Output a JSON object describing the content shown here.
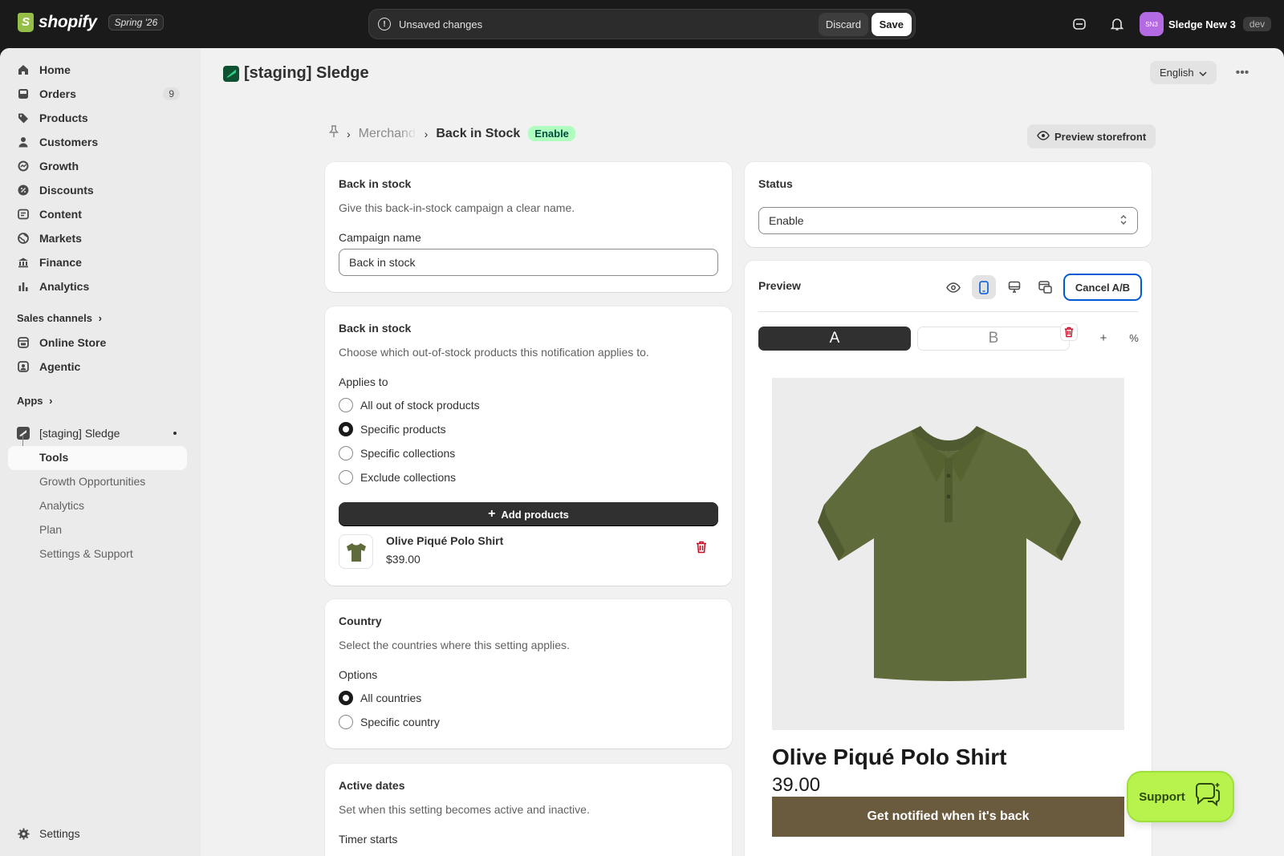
{
  "topbar": {
    "logo_text": "shopify",
    "edition_badge": "Spring '26",
    "unsaved_text": "Unsaved changes",
    "discard_label": "Discard",
    "save_label": "Save",
    "store_initials": "SN3",
    "store_name": "Sledge New 3",
    "env_badge": "dev"
  },
  "sidebar": {
    "items": [
      {
        "label": "Home",
        "icon": "home-icon"
      },
      {
        "label": "Orders",
        "icon": "inbox-icon",
        "count": "9"
      },
      {
        "label": "Products",
        "icon": "tag-icon"
      },
      {
        "label": "Customers",
        "icon": "person-icon"
      },
      {
        "label": "Growth",
        "icon": "growth-icon"
      },
      {
        "label": "Discounts",
        "icon": "discount-icon"
      },
      {
        "label": "Content",
        "icon": "content-icon"
      },
      {
        "label": "Markets",
        "icon": "globe-icon"
      },
      {
        "label": "Finance",
        "icon": "bank-icon"
      },
      {
        "label": "Analytics",
        "icon": "bar-chart-icon"
      }
    ],
    "sales_channels_label": "Sales channels",
    "channels": [
      {
        "label": "Online Store",
        "icon": "store-icon"
      },
      {
        "label": "Agentic",
        "icon": "agent-icon"
      }
    ],
    "apps_label": "Apps",
    "app_name": "[staging] Sledge",
    "app_subitems": [
      "Tools",
      "Growth Opportunities",
      "Analytics",
      "Plan",
      "Settings & Support"
    ],
    "settings_label": "Settings"
  },
  "page": {
    "title": "[staging] Sledge",
    "language": "English",
    "breadcrumb_parent": "Merchandise",
    "breadcrumb_current": "Back in Stock",
    "status_badge": "Enable",
    "preview_storefront_label": "Preview storefront"
  },
  "campaign_card": {
    "title": "Back in stock",
    "subtitle": "Give this back-in-stock campaign a clear name.",
    "field_label": "Campaign name",
    "field_value": "Back in stock"
  },
  "applies_card": {
    "title": "Back in stock",
    "subtitle": "Choose which out-of-stock products this notification applies to.",
    "applies_label": "Applies to",
    "options": [
      "All out of stock products",
      "Specific products",
      "Specific collections",
      "Exclude collections"
    ],
    "selected_index": 1,
    "add_button_label": "Add products",
    "product_name": "Olive Piqué Polo Shirt",
    "product_price": "$39.00"
  },
  "country_card": {
    "title": "Country",
    "subtitle": "Select the countries where this setting applies.",
    "options_label": "Options",
    "options": [
      "All countries",
      "Specific country"
    ],
    "selected_index": 0
  },
  "dates_card": {
    "title": "Active dates",
    "subtitle": "Set when this setting becomes active and inactive.",
    "timer_label": "Timer starts"
  },
  "status_card": {
    "title": "Status",
    "value": "Enable"
  },
  "preview_card": {
    "title": "Preview",
    "cancel_ab_label": "Cancel A/B",
    "variant_a": "A",
    "variant_b": "B",
    "product_name": "Olive Piqué Polo Shirt",
    "product_price": "39.00",
    "notify_button_label": "Get notified when it's back"
  },
  "support_label": "Support",
  "colors": {
    "topbar": "#1a1a1a",
    "shirt": "#5f6b3b",
    "notify_button": "#6b5b3e",
    "support_button": "#b7f34c",
    "enable_badge": "#affebf",
    "accent": "#005bd3"
  }
}
